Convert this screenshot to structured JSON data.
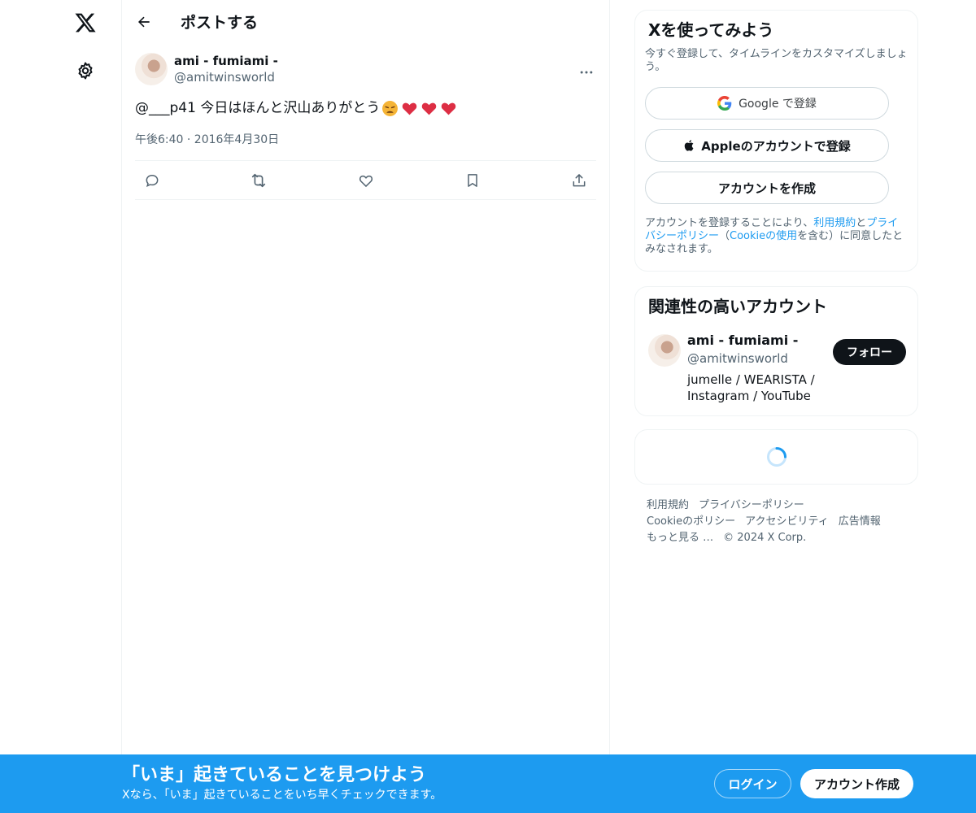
{
  "nav": {
    "logo_icon": "x-logo-icon",
    "settings_icon": "gear-icon"
  },
  "header": {
    "title": "ポストする",
    "back_icon": "arrow-left-icon"
  },
  "post": {
    "author_name": "ami - fumiami -",
    "author_handle": "@amitwinsworld",
    "text": "@___p41 今日はほんと沢山ありがとう",
    "emojis": [
      "weary-face",
      "heart",
      "heart",
      "heart"
    ],
    "time": "午後6:40 · 2016年4月30日",
    "actions": [
      "reply-icon",
      "repost-icon",
      "like-icon",
      "bookmark-icon",
      "share-icon"
    ]
  },
  "signup": {
    "title": "Xを使ってみよう",
    "subtitle": "今すぐ登録して、タイムラインをカスタマイズしましょう。",
    "google_label": "Google で登録",
    "apple_label": "Appleのアカウントで登録",
    "create_label": "アカウントを作成",
    "legal_prefix": "アカウントを登録することにより、",
    "terms_link": "利用規約",
    "legal_and": "と",
    "privacy_link": "プライバシーポリシー",
    "legal_paren_open": "（",
    "cookie_link": "Cookieの使用",
    "legal_suffix": "を含む）に同意したとみなされます。"
  },
  "related": {
    "title": "関連性の高いアカウント",
    "name": "ami - fumiami -",
    "handle": "@amitwinsworld",
    "bio": "jumelle / WEARISTA / Instagram / YouTube",
    "follow_label": "フォロー"
  },
  "footer": {
    "terms": "利用規約",
    "privacy": "プライバシーポリシー",
    "cookie": "Cookieのポリシー",
    "accessibility": "アクセシビリティ",
    "ads": "広告情報",
    "more": "もっと見る …",
    "copyright": "© 2024 X Corp."
  },
  "bottom_bar": {
    "title": "「いま」起きていることを見つけよう",
    "subtitle": "Xなら、「いま」起きていることをいち早くチェックできます。",
    "login_label": "ログイン",
    "create_label": "アカウント作成"
  },
  "colors": {
    "accent": "#1d9bf0",
    "text": "#0f1419",
    "muted": "#536471",
    "border": "#eff3f4"
  }
}
